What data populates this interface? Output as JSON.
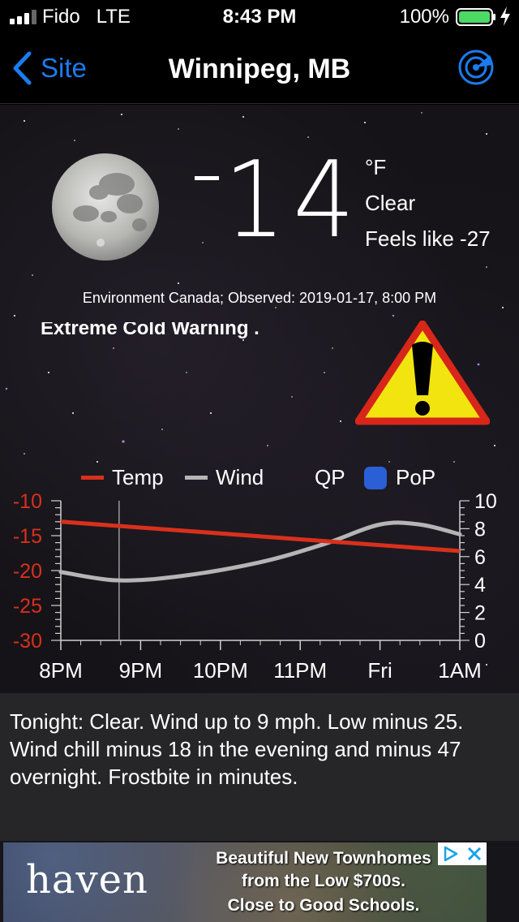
{
  "status_bar": {
    "carrier": "Fido",
    "network": "LTE",
    "time": "8:43 PM",
    "battery": "100%",
    "battery_level": 1.0,
    "signal_bars_filled": 3,
    "signal_bars_total": 4
  },
  "nav": {
    "back_label": "Site",
    "title": "Winnipeg, MB",
    "accent_color": "#1a7cf0"
  },
  "current": {
    "temp_sign": "-",
    "temp_value": "14",
    "unit": "°F",
    "condition": "Clear",
    "feels_like": "Feels like -27",
    "observed": "Environment Canada; Observed: 2019-01-17, 8:00 PM"
  },
  "warning": {
    "text": "Extreme Cold Warning .",
    "icon": "warning-triangle-icon"
  },
  "chart_data": {
    "type": "line",
    "legend": [
      "Temp",
      "Wind",
      "QP",
      "PoP"
    ],
    "legend_colors": {
      "Temp": "#d8301c",
      "Wind": "#b5b5b5",
      "PoP": "#2a5fd6"
    },
    "categories": [
      "8PM",
      "9PM",
      "10PM",
      "11PM",
      "Fri",
      "1AM"
    ],
    "left_axis": {
      "ticks": [
        "-10",
        "-15",
        "-20",
        "-25",
        "-30"
      ],
      "range": [
        -30,
        -10
      ],
      "color": "#d8301c"
    },
    "right_axis": {
      "ticks": [
        "10",
        "8",
        "6",
        "4",
        "2",
        "0"
      ],
      "range": [
        0,
        10
      ]
    },
    "series": [
      {
        "name": "Temp",
        "x": [
          0,
          5
        ],
        "values": [
          -13,
          -17.2
        ]
      },
      {
        "name": "Wind",
        "x": [
          0,
          0.7,
          1.5,
          2.5,
          3.3,
          4,
          4.5,
          5
        ],
        "values": [
          4.9,
          4.3,
          4.6,
          5.6,
          6.9,
          8.3,
          8.3,
          7.6
        ]
      }
    ],
    "now_marker_x": 0.73
  },
  "forecast": {
    "text": "Tonight:  Clear. Wind up to 9 mph. Low minus 25. Wind chill minus 18 in the evening and minus 47 overnight. Frostbite in minutes."
  },
  "ad": {
    "logo": "haven",
    "line1": "Beautiful New Townhomes",
    "line2": "from the Low $700s.",
    "line3": "Close to Good Schools."
  }
}
